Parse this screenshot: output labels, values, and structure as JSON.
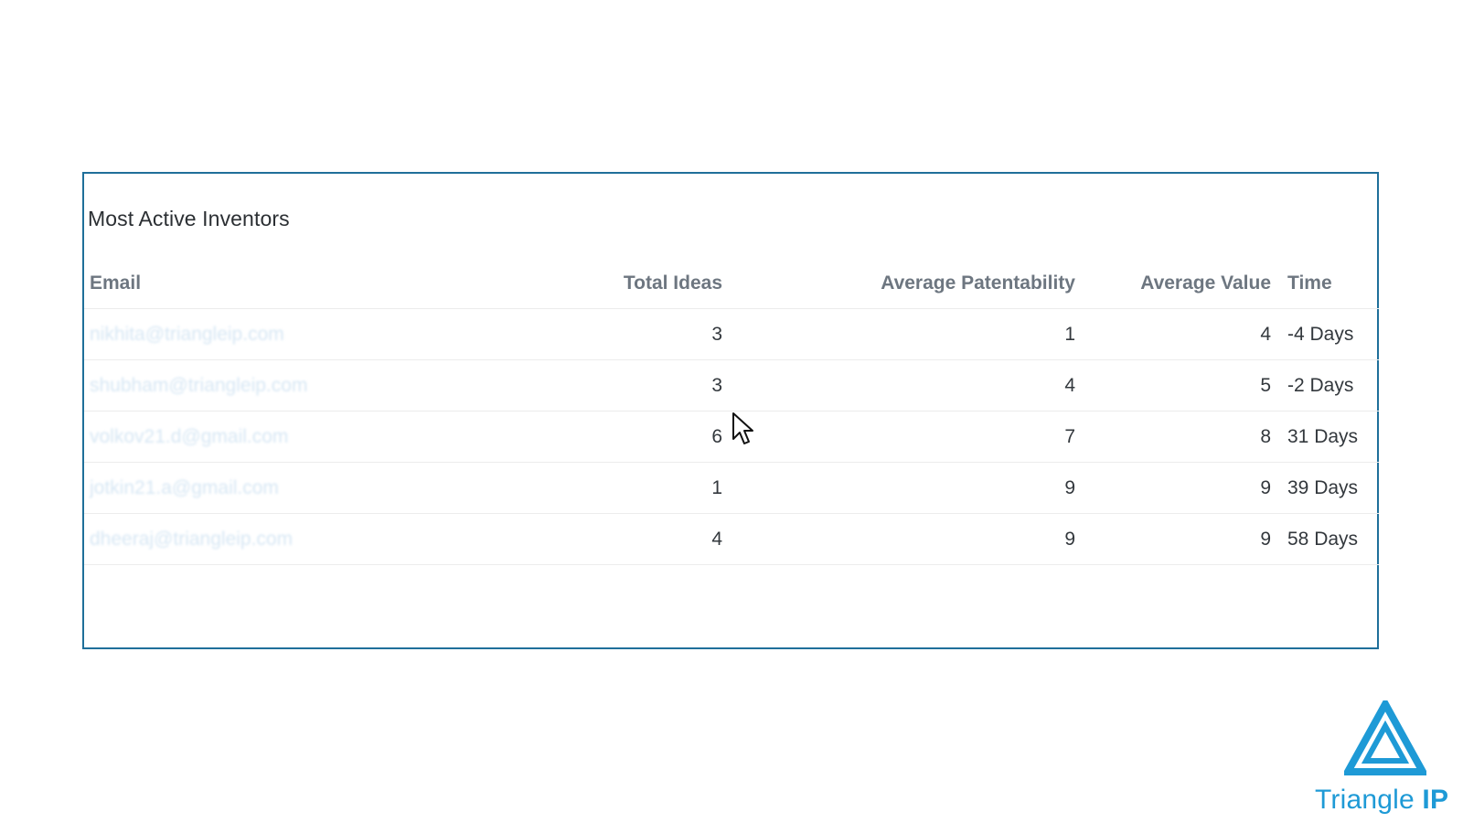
{
  "widget": {
    "title": "Most Active Inventors"
  },
  "table": {
    "columns": {
      "email": "Email",
      "total_ideas": "Total Ideas",
      "avg_patentability": "Average Patentability",
      "avg_value": "Average Value",
      "time": "Time"
    },
    "rows": [
      {
        "email": "nikhita@triangleip.com",
        "total_ideas": "3",
        "avg_patentability": "1",
        "avg_value": "4",
        "time": "-4 Days"
      },
      {
        "email": "shubham@triangleip.com",
        "total_ideas": "3",
        "avg_patentability": "4",
        "avg_value": "5",
        "time": "-2 Days"
      },
      {
        "email": "volkov21.d@gmail.com",
        "total_ideas": "6",
        "avg_patentability": "7",
        "avg_value": "8",
        "time": "31 Days"
      },
      {
        "email": "jotkin21.a@gmail.com",
        "total_ideas": "1",
        "avg_patentability": "9",
        "avg_value": "9",
        "time": "39 Days"
      },
      {
        "email": "dheeraj@triangleip.com",
        "total_ideas": "4",
        "avg_patentability": "9",
        "avg_value": "9",
        "time": "58 Days"
      }
    ]
  },
  "brand": {
    "name_regular": "Triangle ",
    "name_bold": "IP",
    "color": "#1e9ad6"
  },
  "colors": {
    "card_border": "#1f6f9a",
    "header_text": "#6d7680",
    "body_text": "#33383d"
  },
  "icons": {
    "cursor": "mouse-pointer-icon",
    "logo": "triangle-ip-logo-icon"
  }
}
